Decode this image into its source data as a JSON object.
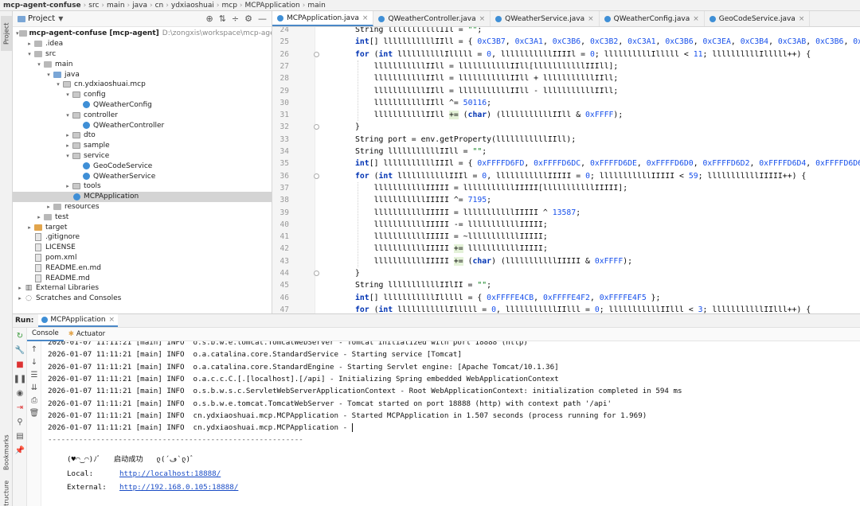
{
  "breadcrumb": [
    "mcp-agent-confuse",
    "src",
    "main",
    "java",
    "cn",
    "ydxiaoshuai",
    "mcp",
    "MCPApplication",
    "main"
  ],
  "left_strip": {
    "project_label": "Project",
    "bookmarks_label": "Bookmarks",
    "structure_label": "Structure"
  },
  "project_panel": {
    "title": "Project",
    "tree": [
      {
        "depth": 0,
        "arrow": "v",
        "icon": "folder",
        "label": "mcp-agent-confuse [mcp-agent]",
        "path": "D:\\zongxis\\workspace\\mcp-agent-confuse",
        "bold": true
      },
      {
        "depth": 1,
        "arrow": ">",
        "icon": "folder",
        "label": ".idea"
      },
      {
        "depth": 1,
        "arrow": "v",
        "icon": "folder",
        "label": "src"
      },
      {
        "depth": 2,
        "arrow": "v",
        "icon": "folder",
        "label": "main"
      },
      {
        "depth": 3,
        "arrow": "v",
        "icon": "folder-blue",
        "label": "java"
      },
      {
        "depth": 4,
        "arrow": "v",
        "icon": "package",
        "label": "cn.ydxiaoshuai.mcp"
      },
      {
        "depth": 5,
        "arrow": "v",
        "icon": "package",
        "label": "config"
      },
      {
        "depth": 6,
        "arrow": "",
        "icon": "class",
        "label": "QWeatherConfig"
      },
      {
        "depth": 5,
        "arrow": "v",
        "icon": "package",
        "label": "controller"
      },
      {
        "depth": 6,
        "arrow": "",
        "icon": "class",
        "label": "QWeatherController"
      },
      {
        "depth": 5,
        "arrow": ">",
        "icon": "package",
        "label": "dto"
      },
      {
        "depth": 5,
        "arrow": ">",
        "icon": "package",
        "label": "sample"
      },
      {
        "depth": 5,
        "arrow": "v",
        "icon": "package",
        "label": "service"
      },
      {
        "depth": 6,
        "arrow": "",
        "icon": "class",
        "label": "GeoCodeService"
      },
      {
        "depth": 6,
        "arrow": "",
        "icon": "class",
        "label": "QWeatherService"
      },
      {
        "depth": 5,
        "arrow": ">",
        "icon": "package",
        "label": "tools"
      },
      {
        "depth": 5,
        "arrow": "",
        "icon": "class",
        "label": "MCPApplication",
        "selected": true
      },
      {
        "depth": 3,
        "arrow": ">",
        "icon": "folder",
        "label": "resources"
      },
      {
        "depth": 2,
        "arrow": ">",
        "icon": "folder",
        "label": "test"
      },
      {
        "depth": 1,
        "arrow": ">",
        "icon": "folder-orange",
        "label": "target"
      },
      {
        "depth": 1,
        "arrow": "",
        "icon": "file",
        "label": ".gitignore"
      },
      {
        "depth": 1,
        "arrow": "",
        "icon": "file",
        "label": "LICENSE"
      },
      {
        "depth": 1,
        "arrow": "",
        "icon": "file",
        "label": "pom.xml"
      },
      {
        "depth": 1,
        "arrow": "",
        "icon": "file",
        "label": "README.en.md"
      },
      {
        "depth": 1,
        "arrow": "",
        "icon": "file",
        "label": "README.md"
      },
      {
        "depth": 0,
        "arrow": ">",
        "icon": "library",
        "label": "External Libraries"
      },
      {
        "depth": 0,
        "arrow": ">",
        "icon": "scratch",
        "label": "Scratches and Consoles"
      }
    ]
  },
  "editor_tabs": [
    {
      "label": "MCPApplication.java",
      "active": true
    },
    {
      "label": "QWeatherController.java"
    },
    {
      "label": "QWeatherService.java"
    },
    {
      "label": "QWeatherConfig.java"
    },
    {
      "label": "GeoCodeService.java"
    }
  ],
  "code_lines": [
    {
      "n": "24",
      "t": "String lllllllllllIIl = \"\";"
    },
    {
      "n": "25",
      "t": "int[] lllllllllllIIll = { 0xC3B7, 0xC3A1, 0xC3B6, 0xC3B2, 0xC3A1, 0xC3B6, 0xC3EA, 0xC3B4, 0xC3AB, 0xC3B6, 0xC3ad"
    },
    {
      "n": "26",
      "t": "for (int llllllllllIlllll = 0, lllllllllllIIIIl = 0; llllllllllIlllll < 11; llllllllllIlllll++) {"
    },
    {
      "n": "27",
      "t": "    lllllllllllIIll = lllllllllllIIll[lllllllllllIIIll];"
    },
    {
      "n": "28",
      "t": "    lllllllllllIIll = lllllllllllIIll + lllllllllllIIll;"
    },
    {
      "n": "29",
      "t": "    lllllllllllIIll = lllllllllllIIll - lllllllllllIIll;"
    },
    {
      "n": "30",
      "t": "    lllllllllllIIll ^= 50116;"
    },
    {
      "n": "31",
      "t": "    lllllllllllIIll += (char) (lllllllllllIIll & 0xFFFF);"
    },
    {
      "n": "32",
      "t": "}"
    },
    {
      "n": "33",
      "t": "String port = env.getProperty(lllllllllllIIll);"
    },
    {
      "n": "34",
      "t": "String lllllllllllIIll = \"\";"
    },
    {
      "n": "35",
      "t": "int[] lllllllllllIIIl = { 0xFFFFD6FD, 0xFFFFD6DC, 0xFFFFD6DE, 0xFFFFD6D0, 0xFFFFD6D2, 0xFFFFD6D4, 0xFFFFD6D6, 0x"
    },
    {
      "n": "36",
      "t": "for (int lllllllllllIIIl = 0, lllllllllllIIIII = 0; lllllllllllIIIII < 59; lllllllllllIIIII++) {"
    },
    {
      "n": "37",
      "t": "    lllllllllllIIIII = lllllllllllIIIII[lllllllllllIIIII];"
    },
    {
      "n": "38",
      "t": "    lllllllllllIIIII ^= 7195;"
    },
    {
      "n": "39",
      "t": "    lllllllllllIIIII = lllllllllllIIIII ^ 13587;"
    },
    {
      "n": "40",
      "t": "    lllllllllllIIIII -= lllllllllllIIIII;"
    },
    {
      "n": "41",
      "t": "    lllllllllllIIIII = ~lllllllllllIIIII;"
    },
    {
      "n": "42",
      "t": "    lllllllllllIIIII += lllllllllllIIIII;"
    },
    {
      "n": "43",
      "t": "    lllllllllllIIIII += (char) (lllllllllllIIIII & 0xFFFF);"
    },
    {
      "n": "44",
      "t": "}"
    },
    {
      "n": "45",
      "t": "String lllllllllllIIlII = \"\";"
    },
    {
      "n": "46",
      "t": "int[] lllllllllllIlllll = { 0xFFFFE4CB, 0xFFFFE4F2, 0xFFFFE4F5 };"
    },
    {
      "n": "47",
      "t": "for (int lllllllllllIlllll = 0, lllllllllllIIlll = 0; lllllllllllIIlll < 3; lllllllllllIIlll++) {"
    }
  ],
  "run_panel": {
    "run_label": "Run:",
    "config_tab": "MCPApplication",
    "sub_tabs": [
      "Console",
      "Actuator"
    ]
  },
  "console_lines": [
    "2026-01-07 11:11:21 [main] INFO  o.s.b.w.e.tomcat.TomcatWebServer - Tomcat initialized with port 18888 (http)",
    "2026-01-07 11:11:21 [main] INFO  o.a.catalina.core.StandardService - Starting service [Tomcat]",
    "2026-01-07 11:11:21 [main] INFO  o.a.catalina.core.StandardEngine - Starting Servlet engine: [Apache Tomcat/10.1.36]",
    "2026-01-07 11:11:21 [main] INFO  o.a.c.c.C.[.[localhost].[/api] - Initializing Spring embedded WebApplicationContext",
    "2026-01-07 11:11:21 [main] INFO  o.s.b.w.s.c.ServletWebServerApplicationContext - Root WebApplicationContext: initialization completed in 594 ms",
    "2026-01-07 11:11:21 [main] INFO  o.s.b.w.e.tomcat.TomcatWebServer - Tomcat started on port 18888 (http) with context path '/api'",
    "2026-01-07 11:11:21 [main] INFO  cn.ydxiaoshuai.mcp.MCPApplication - Started MCPApplication in 1.507 seconds (process running for 1.969)",
    "2026-01-07 11:11:21 [main] INFO  cn.ydxiaoshuai.mcp.MCPApplication - "
  ],
  "console_divider": "----------------------------------------------------------",
  "startup": {
    "banner": "(♥◠‿◠)ﾉﾞ   启动成功   ლ(´ڡ`ლ)ﾞ",
    "local_label": "Local:",
    "local_url": "http://localhost:18888/",
    "external_label": "External:",
    "external_url": "http://192.168.0.105:18888/"
  }
}
